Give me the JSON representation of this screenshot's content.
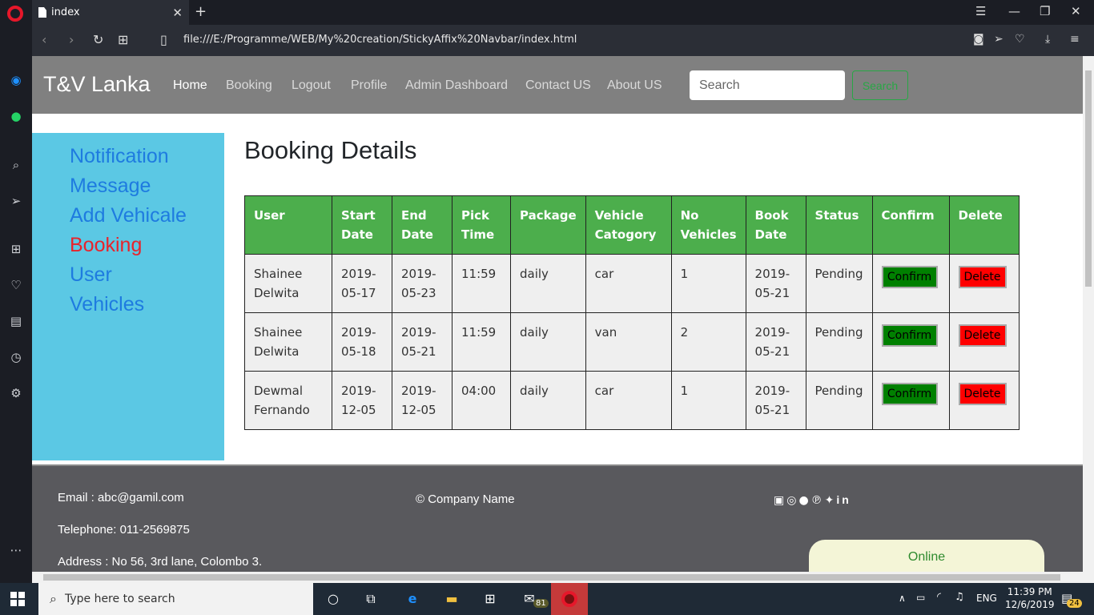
{
  "browser": {
    "tab_title": "index",
    "url": "file:///E:/Programme/WEB/My%20creation/StickyAffix%20Navbar/index.html"
  },
  "site": {
    "brand": "T&V Lanka",
    "nav": [
      "Home",
      "Booking",
      "Logout",
      "Profile",
      "Admin Dashboard",
      "Contact US",
      "About US"
    ],
    "search_placeholder": "Search",
    "search_button": "Search"
  },
  "menu": [
    "Notification",
    "Message",
    "Add Vehicale",
    "Booking",
    "User",
    "Vehicles"
  ],
  "page_title": "Booking Details",
  "table": {
    "headers": [
      "User",
      "Start Date",
      "End Date",
      "Pick Time",
      "Package",
      "Vehicle Catogory",
      "No Vehicles",
      "Book Date",
      "Status",
      "Confirm",
      "Delete"
    ],
    "rows": [
      {
        "user": "Shainee Delwita",
        "start": "2019-05-17",
        "end": "2019-05-23",
        "pick": "11:59",
        "package": "daily",
        "category": "car",
        "count": "1",
        "book": "2019-05-21",
        "status": "Pending"
      },
      {
        "user": "Shainee Delwita",
        "start": "2019-05-18",
        "end": "2019-05-21",
        "pick": "11:59",
        "package": "daily",
        "category": "van",
        "count": "2",
        "book": "2019-05-21",
        "status": "Pending"
      },
      {
        "user": "Dewmal Fernando",
        "start": "2019-12-05",
        "end": "2019-12-05",
        "pick": "04:00",
        "package": "daily",
        "category": "car",
        "count": "1",
        "book": "2019-05-21",
        "status": "Pending"
      }
    ],
    "confirm_label": "Confirm",
    "delete_label": "Delete"
  },
  "footer": {
    "email": "Email : abc@gamil.com",
    "telephone": "Telephone: 011-2569875",
    "address": "Address : No 56, 3rd lane, Colombo 3.",
    "company": "© Company Name",
    "social_icons": [
      "facebook-icon",
      "instagram-icon",
      "snapchat-icon",
      "pinterest-icon",
      "twitter-icon",
      "linkedin-icon"
    ]
  },
  "online_label": "Online",
  "taskbar": {
    "search_placeholder": "Type here to search",
    "mail_badge": "81",
    "language": "ENG",
    "time": "11:39 PM",
    "date": "12/6/2019",
    "notification_count": "24"
  },
  "colors": {
    "navbar": "#808080",
    "menu_bg": "#5bc8e4",
    "menu_link": "#1e7be0",
    "menu_active": "#e8232b",
    "table_header": "#4cae4c",
    "confirm": "#008000",
    "delete": "#ff0000"
  }
}
